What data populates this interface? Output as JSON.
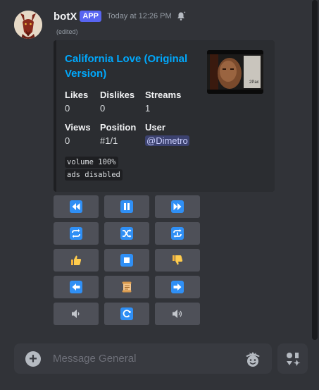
{
  "message": {
    "username": "botX",
    "badge": "APP",
    "timestamp": "Today at 12:26 PM",
    "edited": "(edited)"
  },
  "embed": {
    "title": "California Love (Original Version)",
    "thumbnail_caption": "2Pac",
    "fields": [
      {
        "name": "Likes",
        "value": "0"
      },
      {
        "name": "Dislikes",
        "value": "0"
      },
      {
        "name": "Streams",
        "value": "1"
      },
      {
        "name": "Views",
        "value": "0"
      },
      {
        "name": "Position",
        "value": "#1/1"
      },
      {
        "name": "User",
        "value": "@Dimetro"
      }
    ],
    "code_lines": [
      "volume 100%",
      "ads disabled"
    ]
  },
  "buttons": [
    {
      "name": "rewind-icon"
    },
    {
      "name": "pause-icon"
    },
    {
      "name": "fast-forward-icon"
    },
    {
      "name": "repeat-icon"
    },
    {
      "name": "shuffle-icon"
    },
    {
      "name": "repeat-one-icon"
    },
    {
      "name": "thumbs-up-icon"
    },
    {
      "name": "stop-icon"
    },
    {
      "name": "thumbs-down-icon"
    },
    {
      "name": "previous-arrow-icon"
    },
    {
      "name": "queue-scroll-icon"
    },
    {
      "name": "next-arrow-icon"
    },
    {
      "name": "volume-down-icon"
    },
    {
      "name": "refresh-icon"
    },
    {
      "name": "volume-up-icon"
    }
  ],
  "composer": {
    "placeholder": "Message General"
  },
  "colors": {
    "background": "#313338",
    "embed_bg": "#2b2d31",
    "link": "#00a8fc",
    "button_bg": "#4e5058",
    "icon_blue": "#2f8ff5",
    "app_badge": "#5865f2"
  }
}
